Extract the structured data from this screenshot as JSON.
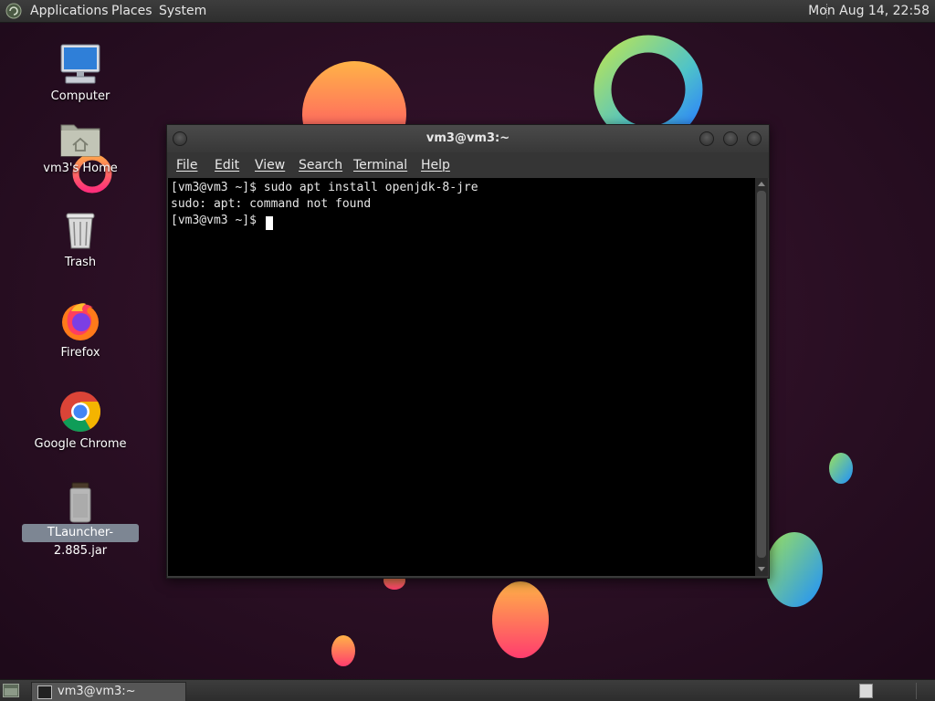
{
  "top_panel": {
    "menus": [
      "Applications",
      "Places",
      "System"
    ],
    "clock": "Mon Aug 14, 22:58"
  },
  "desktop": {
    "icons": [
      {
        "label": "Computer",
        "icon": "computer-icon"
      },
      {
        "label": "vm3's Home",
        "icon": "home-folder-icon"
      },
      {
        "label": "Trash",
        "icon": "trash-icon"
      },
      {
        "label": "Firefox",
        "icon": "firefox-icon"
      },
      {
        "label": "Google Chrome",
        "icon": "chrome-icon"
      },
      {
        "label": "TLauncher-2.885.jar",
        "icon": "jar-icon",
        "selected": true
      }
    ]
  },
  "terminal": {
    "title": "vm3@vm3:~",
    "menus": [
      "File",
      "Edit",
      "View",
      "Search",
      "Terminal",
      "Help"
    ],
    "lines": [
      "[vm3@vm3 ~]$ sudo apt install openjdk-8-jre",
      "sudo: apt: command not found",
      "[vm3@vm3 ~]$ "
    ]
  },
  "taskbar": {
    "tasks": [
      {
        "label": "vm3@vm3:~",
        "icon": "terminal-icon"
      }
    ]
  },
  "colors": {
    "desktop_bg": "#2a0f23",
    "panel_bg": "#3a3a3a",
    "terminal_bg": "#000000",
    "selection": "#7d8693"
  }
}
